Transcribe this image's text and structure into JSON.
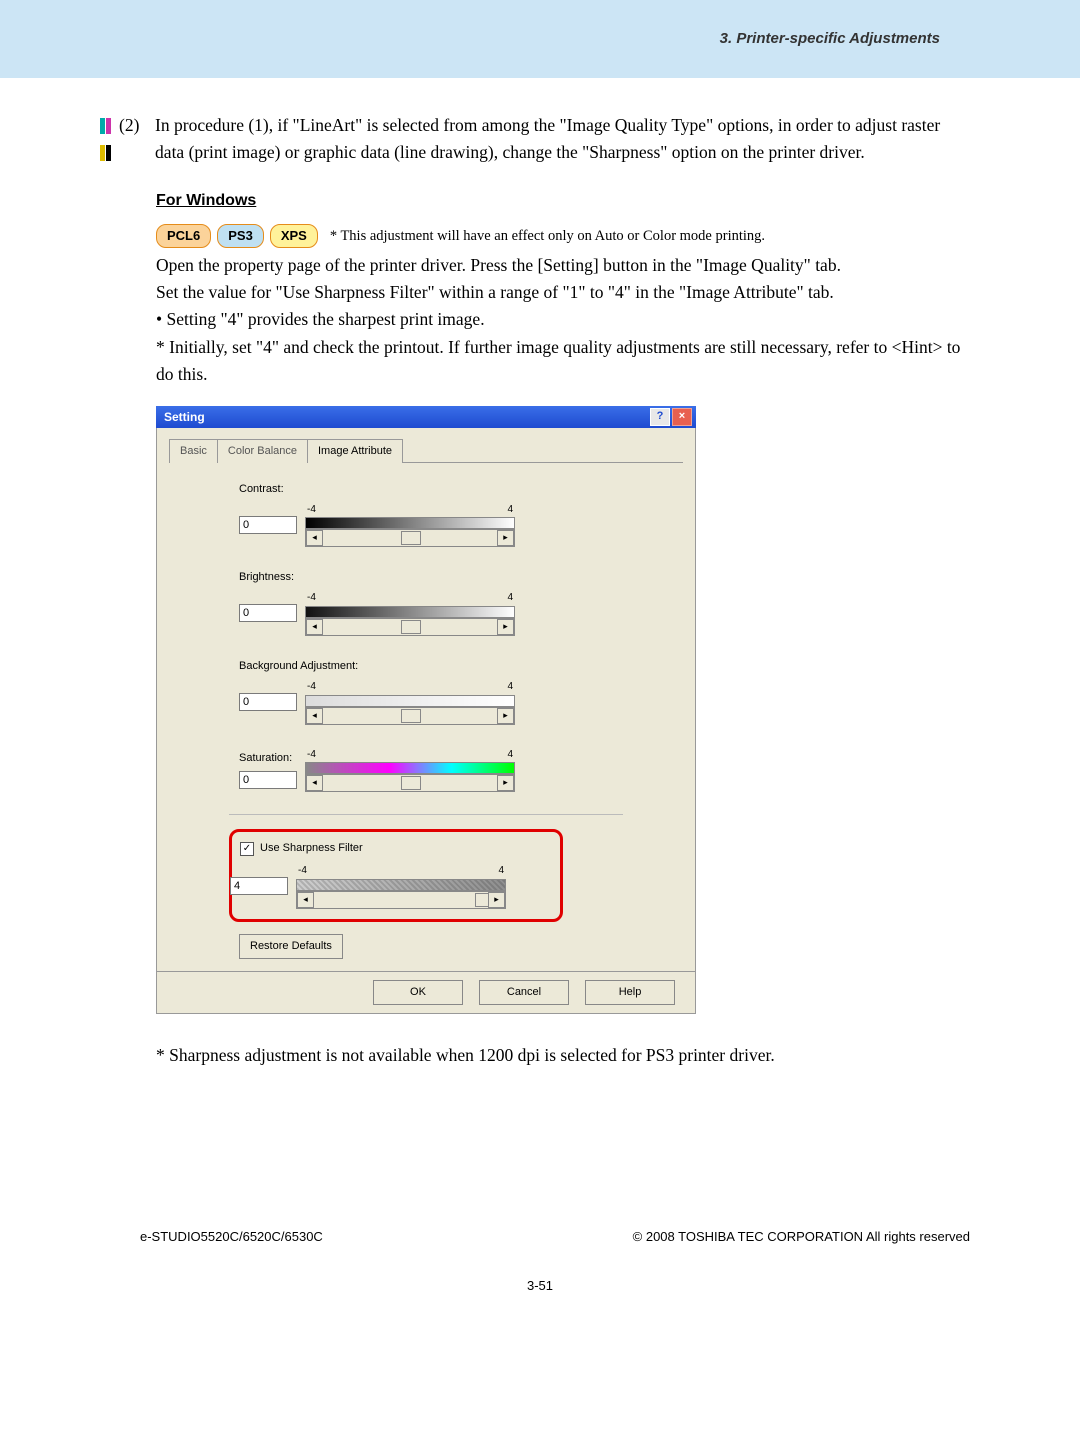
{
  "header": {
    "section_title": "3. Printer-specific Adjustments"
  },
  "step": {
    "number": "(2)",
    "paragraph": "In procedure (1), if \"LineArt\" is selected from among the \"Image Quality Type\" options, in order to adjust raster data (print image) or graphic data (line drawing), change the \"Sharpness\" option on the printer driver."
  },
  "windows": {
    "heading": "For Windows",
    "pills": {
      "pcl6": "PCL6",
      "ps3": "PS3",
      "xps": "XPS"
    },
    "pill_note": "* This adjustment will have an effect only on Auto or Color mode printing.",
    "line1": "Open the property page of the printer driver.  Press the [Setting] button in the \"Image Quality\" tab.",
    "line2": "Set the value for \"Use Sharpness Filter\" within a range of \"1\" to \"4\" in the \"Image Attribute\" tab.",
    "bullet": "Setting \"4\" provides the sharpest print image.",
    "hint": "Initially, set \"4\" and check the printout.  If further image quality adjustments are still necessary, refer to <Hint> to do this."
  },
  "dialog": {
    "title": "Setting",
    "help_glyph": "?",
    "close_glyph": "×",
    "tabs": {
      "basic": "Basic",
      "color_balance": "Color Balance",
      "image_attribute": "Image Attribute"
    },
    "fields": {
      "contrast": {
        "label": "Contrast:",
        "value": "0",
        "min": "-4",
        "max": "4"
      },
      "brightness": {
        "label": "Brightness:",
        "value": "0",
        "min": "-4",
        "max": "4"
      },
      "background": {
        "label": "Background Adjustment:",
        "value": "0",
        "min": "-4",
        "max": "4"
      },
      "saturation": {
        "label": "Saturation:",
        "value": "0",
        "min": "-4",
        "max": "4"
      },
      "sharpness": {
        "check_label": "Use Sharpness Filter",
        "checked": true,
        "value": "4",
        "min": "-4",
        "max": "4"
      }
    },
    "restore": "Restore Defaults",
    "buttons": {
      "ok": "OK",
      "cancel": "Cancel",
      "help": "Help"
    }
  },
  "after_note": "Sharpness adjustment is not available when 1200 dpi is selected for PS3 printer driver.",
  "footer": {
    "model": "e-STUDIO5520C/6520C/6530C",
    "copyright": "© 2008 TOSHIBA TEC CORPORATION All rights reserved",
    "page": "3-51"
  }
}
